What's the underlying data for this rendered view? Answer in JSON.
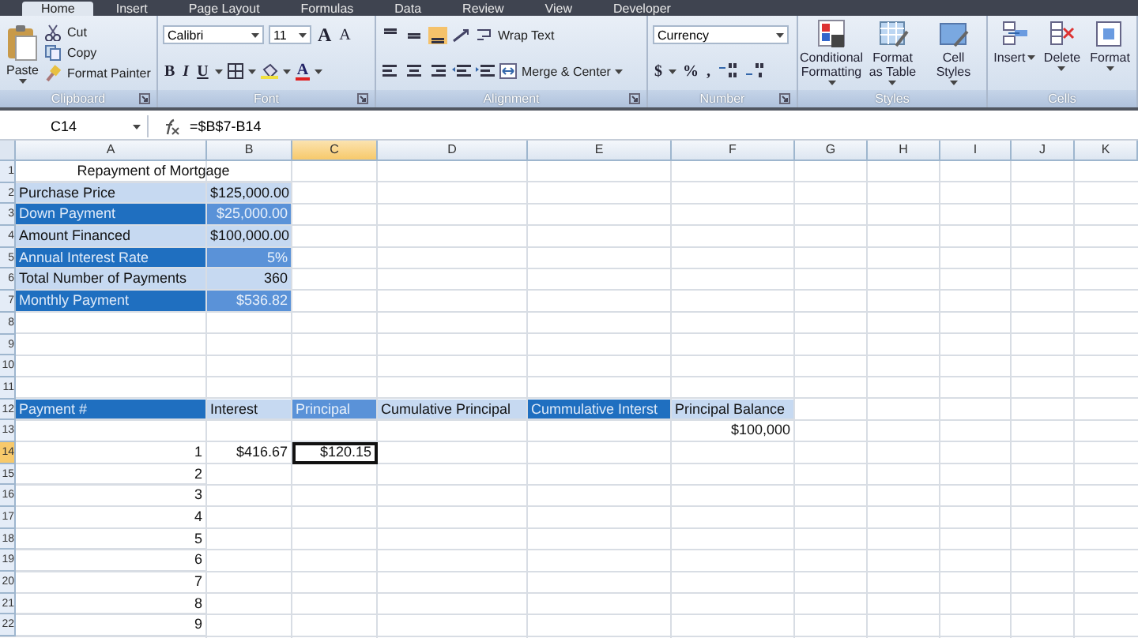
{
  "tabs": [
    {
      "label": "Home",
      "selected": true
    },
    {
      "label": "Insert",
      "selected": false
    },
    {
      "label": "Page Layout",
      "selected": false
    },
    {
      "label": "Formulas",
      "selected": false
    },
    {
      "label": "Data",
      "selected": false
    },
    {
      "label": "Review",
      "selected": false
    },
    {
      "label": "View",
      "selected": false
    },
    {
      "label": "Developer",
      "selected": false
    }
  ],
  "ribbon": {
    "clipboard": {
      "title": "Clipboard",
      "paste": "Paste",
      "actions": [
        "Cut",
        "Copy",
        "Format Painter"
      ]
    },
    "font": {
      "title": "Font",
      "font_name": "Calibri",
      "font_size": "11",
      "size_buttons": [
        "A",
        "A"
      ],
      "style_buttons": [
        "B",
        "I",
        "U"
      ],
      "font_color": "A"
    },
    "alignment": {
      "title": "Alignment",
      "wrap_text": "Wrap Text",
      "merge": "Merge & Center"
    },
    "number": {
      "title": "Number",
      "format": "Currency",
      "symbols": [
        "$",
        "%",
        ","
      ]
    },
    "styles": {
      "title": "Styles",
      "buttons": [
        "Conditional Formatting",
        "Format as Table",
        "Cell Styles"
      ]
    },
    "cells": {
      "title": "Cells",
      "buttons": [
        "Insert",
        "Delete",
        "Format"
      ]
    }
  },
  "formula_bar": {
    "name_box": "C14",
    "formula": "=$B$7-B14"
  },
  "sheet": {
    "column_headers": [
      {
        "label": "A",
        "selected": false
      },
      {
        "label": "B",
        "selected": false
      },
      {
        "label": "C",
        "selected": true
      },
      {
        "label": "D",
        "selected": false
      },
      {
        "label": "E",
        "selected": false
      },
      {
        "label": "F",
        "selected": false
      },
      {
        "label": "G",
        "selected": false
      },
      {
        "label": "H",
        "selected": false
      },
      {
        "label": "I",
        "selected": false
      },
      {
        "label": "J",
        "selected": false
      },
      {
        "label": "K",
        "selected": false
      }
    ],
    "row_headers": [
      {
        "label": "1",
        "selected": false
      },
      {
        "label": "2",
        "selected": false
      },
      {
        "label": "3",
        "selected": false
      },
      {
        "label": "4",
        "selected": false
      },
      {
        "label": "5",
        "selected": false
      },
      {
        "label": "6",
        "selected": false
      },
      {
        "label": "7",
        "selected": false
      },
      {
        "label": "8",
        "selected": false
      },
      {
        "label": "9",
        "selected": false
      },
      {
        "label": "10",
        "selected": false
      },
      {
        "label": "11",
        "selected": false
      },
      {
        "label": "12",
        "selected": false
      },
      {
        "label": "13",
        "selected": false
      },
      {
        "label": "14",
        "selected": true
      },
      {
        "label": "15",
        "selected": false
      },
      {
        "label": "16",
        "selected": false
      },
      {
        "label": "17",
        "selected": false
      },
      {
        "label": "18",
        "selected": false
      },
      {
        "label": "19",
        "selected": false
      },
      {
        "label": "20",
        "selected": false
      },
      {
        "label": "21",
        "selected": false
      },
      {
        "label": "22",
        "selected": false
      }
    ],
    "title": "Repayment of Mortgage",
    "inputs": [
      {
        "label": "Purchase Price",
        "value": "$125,000.00",
        "kind": "light"
      },
      {
        "label": "Down Payment",
        "value": "$25,000.00",
        "kind": "dark"
      },
      {
        "label": "Amount Financed",
        "value": "$100,000.00",
        "kind": "light"
      },
      {
        "label": "Annual Interest Rate",
        "value": "5%",
        "kind": "dark"
      },
      {
        "label": "Total Number of Payments",
        "value": "360",
        "kind": "light"
      },
      {
        "label": "Monthly Payment",
        "value": "$536.82",
        "kind": "dark"
      }
    ],
    "table": {
      "headers": [
        {
          "label": "Payment #",
          "kind": "dark"
        },
        {
          "label": "Interest",
          "kind": "light"
        },
        {
          "label": "Principal",
          "kind": "mid"
        },
        {
          "label": "Cumulative Principal",
          "kind": "light"
        },
        {
          "label": "Cummulative Interst",
          "kind": "dark"
        },
        {
          "label": "Principal Balance",
          "kind": "light"
        }
      ],
      "opening_balance": "$100,000",
      "rows": [
        {
          "number": "1",
          "interest": "$416.67",
          "principal": "$120.15"
        },
        {
          "number": "2"
        },
        {
          "number": "3"
        },
        {
          "number": "4"
        },
        {
          "number": "5"
        },
        {
          "number": "6"
        },
        {
          "number": "7"
        },
        {
          "number": "8"
        },
        {
          "number": "9"
        }
      ]
    }
  }
}
